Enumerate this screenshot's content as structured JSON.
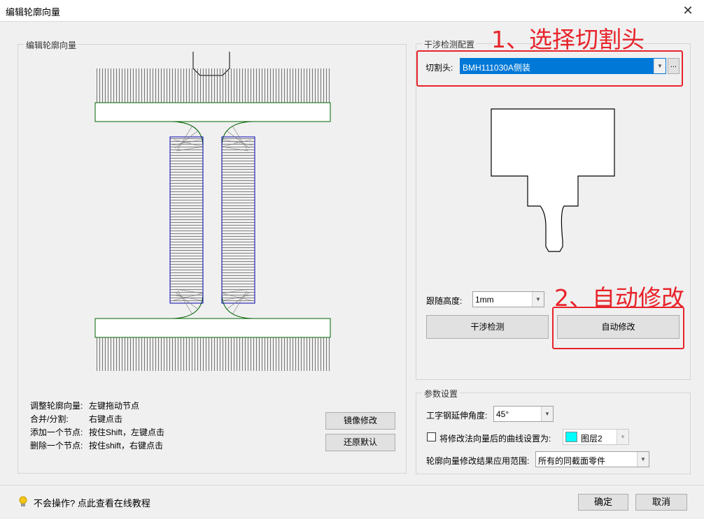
{
  "window": {
    "title": "编辑轮廓向量",
    "close_symbol": "✕"
  },
  "left_panel": {
    "legend": "编辑轮廓向量",
    "help": [
      {
        "k": "调整轮廓向量:",
        "v": "左键拖动节点"
      },
      {
        "k": "合并/分割:",
        "v": "右键点击"
      },
      {
        "k": "添加一个节点:",
        "v": "按住Shift，左键点击"
      },
      {
        "k": "删除一个节点:",
        "v": "按住shift，右键点击"
      }
    ],
    "mirror_button": "镜像修改",
    "restore_button": "还原默认"
  },
  "interference": {
    "legend": "干涉检测配置",
    "cutter_label": "切割头:",
    "cutter_value": "BMH111030A侧装",
    "more_button": "...",
    "follow_label": "跟随高度:",
    "follow_value": "1mm",
    "check_button": "干涉检测",
    "auto_button": "自动修改"
  },
  "params": {
    "legend": "参数设置",
    "angle_label": "工字钢延伸角度:",
    "angle_value": "45°",
    "checkbox_label": "将修改法向量后的曲线设置为:",
    "layer_value": "图层2",
    "layer_color": "#00ffff",
    "scope_label": "轮廓向量修改结果应用范围:",
    "scope_value": "所有的同截面零件"
  },
  "annotations": {
    "step1": "1、选择切割头",
    "step2": "2、自动修改",
    "color": "#e8232a"
  },
  "footer": {
    "tip_icon": "lightbulb-icon",
    "tip_text": "不会操作? 点此查看在线教程",
    "ok_button": "确定",
    "cancel_button": "取消"
  }
}
